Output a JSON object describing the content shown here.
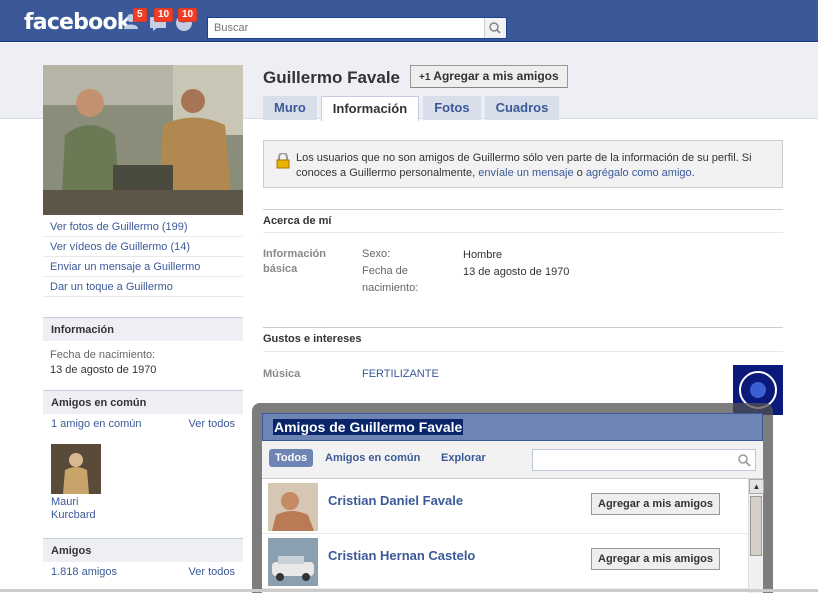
{
  "topbar": {
    "logo": "facebook",
    "badges": {
      "friend_requests": "5",
      "messages": "10",
      "notifications": "10"
    },
    "search_placeholder": "Buscar"
  },
  "sidebar": {
    "links": [
      "Ver fotos de Guillermo (199)",
      "Ver vídeos de Guillermo (14)",
      "Enviar un mensaje a Guillermo",
      "Dar un toque a Guillermo"
    ],
    "info": {
      "title": "Información",
      "birth_label": "Fecha de nacimiento:",
      "birth_value": "13 de agosto de 1970"
    },
    "mutual": {
      "title": "Amigos en común",
      "count": "1 amigo en común",
      "see_all": "Ver todos",
      "friend_name": "Mauri Kurcbard"
    },
    "friends": {
      "title": "Amigos",
      "count": "1.818 amigos",
      "see_all": "Ver todos"
    }
  },
  "profile": {
    "name": "Guillermo Favale",
    "add_friend": "Agregar a mis amigos",
    "add_friend_prefix": "+1",
    "tabs": [
      "Muro",
      "Información",
      "Fotos",
      "Cuadros"
    ],
    "active_tab": "Información"
  },
  "notice": {
    "text_before": "Los usuarios que no son amigos de Guillermo sólo ven parte de la información de su perfil. Si conoces a Guillermo personalmente, ",
    "link1": "envíale un mensaje",
    "middle": " o ",
    "link2": "agrégalo como amigo",
    "text_after": "."
  },
  "about": {
    "title": "Acerca de mí",
    "basic_label": "Información básica",
    "sex_key": "Sexo:",
    "sex_value": "Hombre",
    "birth_key": "Fecha de nacimiento:",
    "birth_value": "13 de agosto de 1970"
  },
  "interests": {
    "title": "Gustos e intereses",
    "music_label": "Música",
    "music_value": "FERTILIZANTE"
  },
  "dialog": {
    "title": "Amigos de Guillermo Favale",
    "filters": [
      "Todos",
      "Amigos en común",
      "Explorar"
    ],
    "friends": [
      {
        "name": "Cristian Daniel Favale",
        "button": "Agregar a mis amigos"
      },
      {
        "name": "Cristian Hernan Castelo",
        "button": "Agregar a mis amigos"
      }
    ]
  },
  "colors": {
    "brand": "#3b5998",
    "badge": "#f03d25",
    "band": "#edeff4"
  }
}
